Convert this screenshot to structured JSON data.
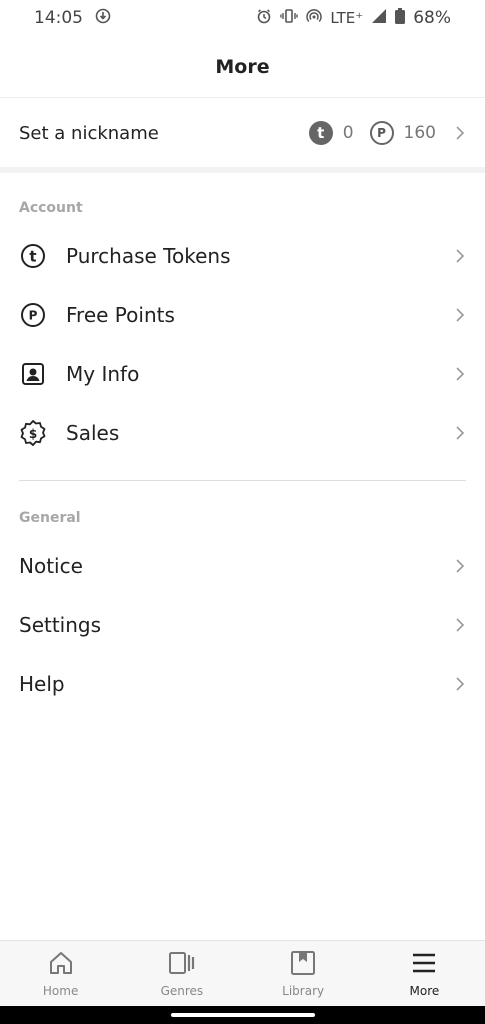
{
  "status_bar": {
    "time": "14:05",
    "network": "LTE⁺",
    "battery": "68%"
  },
  "header": {
    "title": "More"
  },
  "profile": {
    "nickname_label": "Set a nickname",
    "token_symbol": "t",
    "tokens": "0",
    "points_symbol": "P",
    "points": "160"
  },
  "account": {
    "section_title": "Account",
    "items": [
      {
        "label": "Purchase Tokens",
        "icon": "token-icon"
      },
      {
        "label": "Free Points",
        "icon": "points-icon"
      },
      {
        "label": "My Info",
        "icon": "profile-card-icon"
      },
      {
        "label": "Sales",
        "icon": "sale-badge-icon"
      }
    ]
  },
  "general": {
    "section_title": "General",
    "items": [
      {
        "label": "Notice"
      },
      {
        "label": "Settings"
      },
      {
        "label": "Help"
      }
    ]
  },
  "bottom_nav": {
    "items": [
      {
        "label": "Home",
        "icon": "home-icon",
        "active": false
      },
      {
        "label": "Genres",
        "icon": "genres-icon",
        "active": false
      },
      {
        "label": "Library",
        "icon": "library-icon",
        "active": false
      },
      {
        "label": "More",
        "icon": "menu-icon",
        "active": true
      }
    ]
  }
}
